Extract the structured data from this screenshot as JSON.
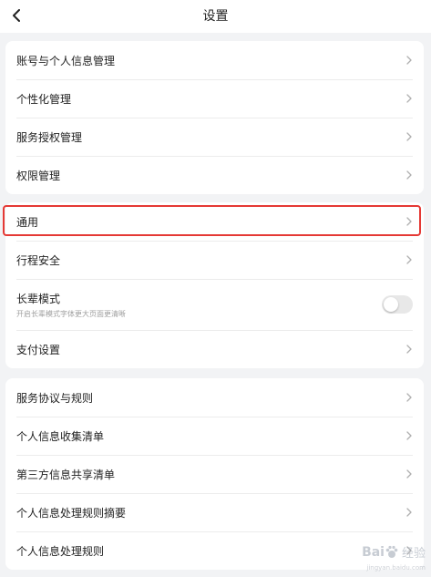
{
  "header": {
    "title": "设置",
    "back_icon": "chevron-left-icon"
  },
  "group1": {
    "items": [
      {
        "label": "账号与个人信息管理"
      },
      {
        "label": "个性化管理"
      },
      {
        "label": "服务授权管理"
      },
      {
        "label": "权限管理"
      }
    ]
  },
  "group2": {
    "items": [
      {
        "label": "通用",
        "highlighted": true
      },
      {
        "label": "行程安全"
      },
      {
        "label": "长辈模式",
        "sub": "开启长辈模式字体更大页面更清晰",
        "toggle": false
      },
      {
        "label": "支付设置"
      }
    ]
  },
  "group3": {
    "items": [
      {
        "label": "服务协议与规则"
      },
      {
        "label": "个人信息收集清单"
      },
      {
        "label": "第三方信息共享清单"
      },
      {
        "label": "个人信息处理规则摘要"
      },
      {
        "label": "个人信息处理规则"
      }
    ]
  },
  "watermark": {
    "brand": "Bai",
    "brand_suffix": "经验",
    "url": "jingyan.baidu.com"
  },
  "colors": {
    "background": "#f2f3f5",
    "card": "#ffffff",
    "highlight": "#e53935",
    "chevron": "#b0b0b0"
  }
}
